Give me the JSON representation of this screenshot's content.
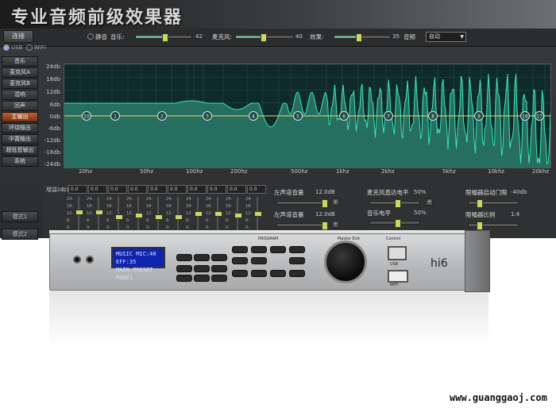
{
  "app": {
    "title": "专业音频前级效果器"
  },
  "topbar": {
    "connect_label": "连接",
    "usb_label": "USB",
    "wifi_label": "WIFI",
    "mute_label": "静音",
    "music_label": "音乐:",
    "music_value": "42",
    "mic_label": "麦克风:",
    "mic_value": "40",
    "effect_label": "效果:",
    "effect_value": "35",
    "freq_label": "音频",
    "mode_select": "自动"
  },
  "sidebar": {
    "items": [
      {
        "label": "音乐"
      },
      {
        "label": "麦克风A"
      },
      {
        "label": "麦克风B"
      },
      {
        "label": "混响"
      },
      {
        "label": "回声"
      },
      {
        "label": "主输出"
      },
      {
        "label": "环绕输出"
      },
      {
        "label": "中置输出"
      },
      {
        "label": "超低音输出"
      },
      {
        "label": "系统"
      }
    ],
    "active_index": 5,
    "mode1_label": "模式1",
    "mode2_label": "模式2"
  },
  "graph": {
    "db_ticks": [
      "24db",
      "18db",
      "12db",
      "6db",
      "0db",
      "-6db",
      "-12db",
      "-18db",
      "-24db"
    ],
    "hz_ticks": [
      "20hz",
      "50hz",
      "100hz",
      "200hz",
      "500hz",
      "1khz",
      "2khz",
      "5khz",
      "10khz",
      "20khz"
    ],
    "nodes": [
      "10",
      "1",
      "2",
      "3",
      "4",
      "5",
      "6",
      "7",
      "8",
      "9",
      "16",
      "17"
    ],
    "curve_color": "#3be8b8",
    "fill_color": "#2a7a68"
  },
  "eq_panel": {
    "gain_label": "增益(db)",
    "values": [
      "0.0",
      "0.0",
      "0.0",
      "0.0",
      "0.0",
      "0.0",
      "0.0",
      "0.0",
      "0.0",
      "0.0"
    ],
    "scale": [
      "24-",
      "18-",
      "12-",
      "6-",
      "0-",
      "-6"
    ]
  },
  "mid_panel": {
    "left_main_label": "左声道音量",
    "left_main_value": "12.0dB",
    "left_vol_label": "左声道音量",
    "left_vol_value": "12.0dB",
    "mic_direct_label": "麦克风直达电平",
    "mic_direct_value": "50%",
    "music_level_label": "音乐电平",
    "music_level_value": "50%",
    "limiter_label": "限幅器启动门限",
    "limiter_value": "-40db",
    "ratio_label": "限幅器比例",
    "ratio_value": "1:4"
  },
  "device": {
    "lcd_line1": "MUSIC MIC:40 EFF:35",
    "lcd_line2": "MAIN PRESET MODE1",
    "brand": "hi6",
    "usb_label": "USB",
    "wifi_label": "WIFI",
    "program_label": "PROGRAM",
    "control_label": "Control",
    "master_label": "Master Exit"
  },
  "watermark": "www.guanggaoj.com"
}
